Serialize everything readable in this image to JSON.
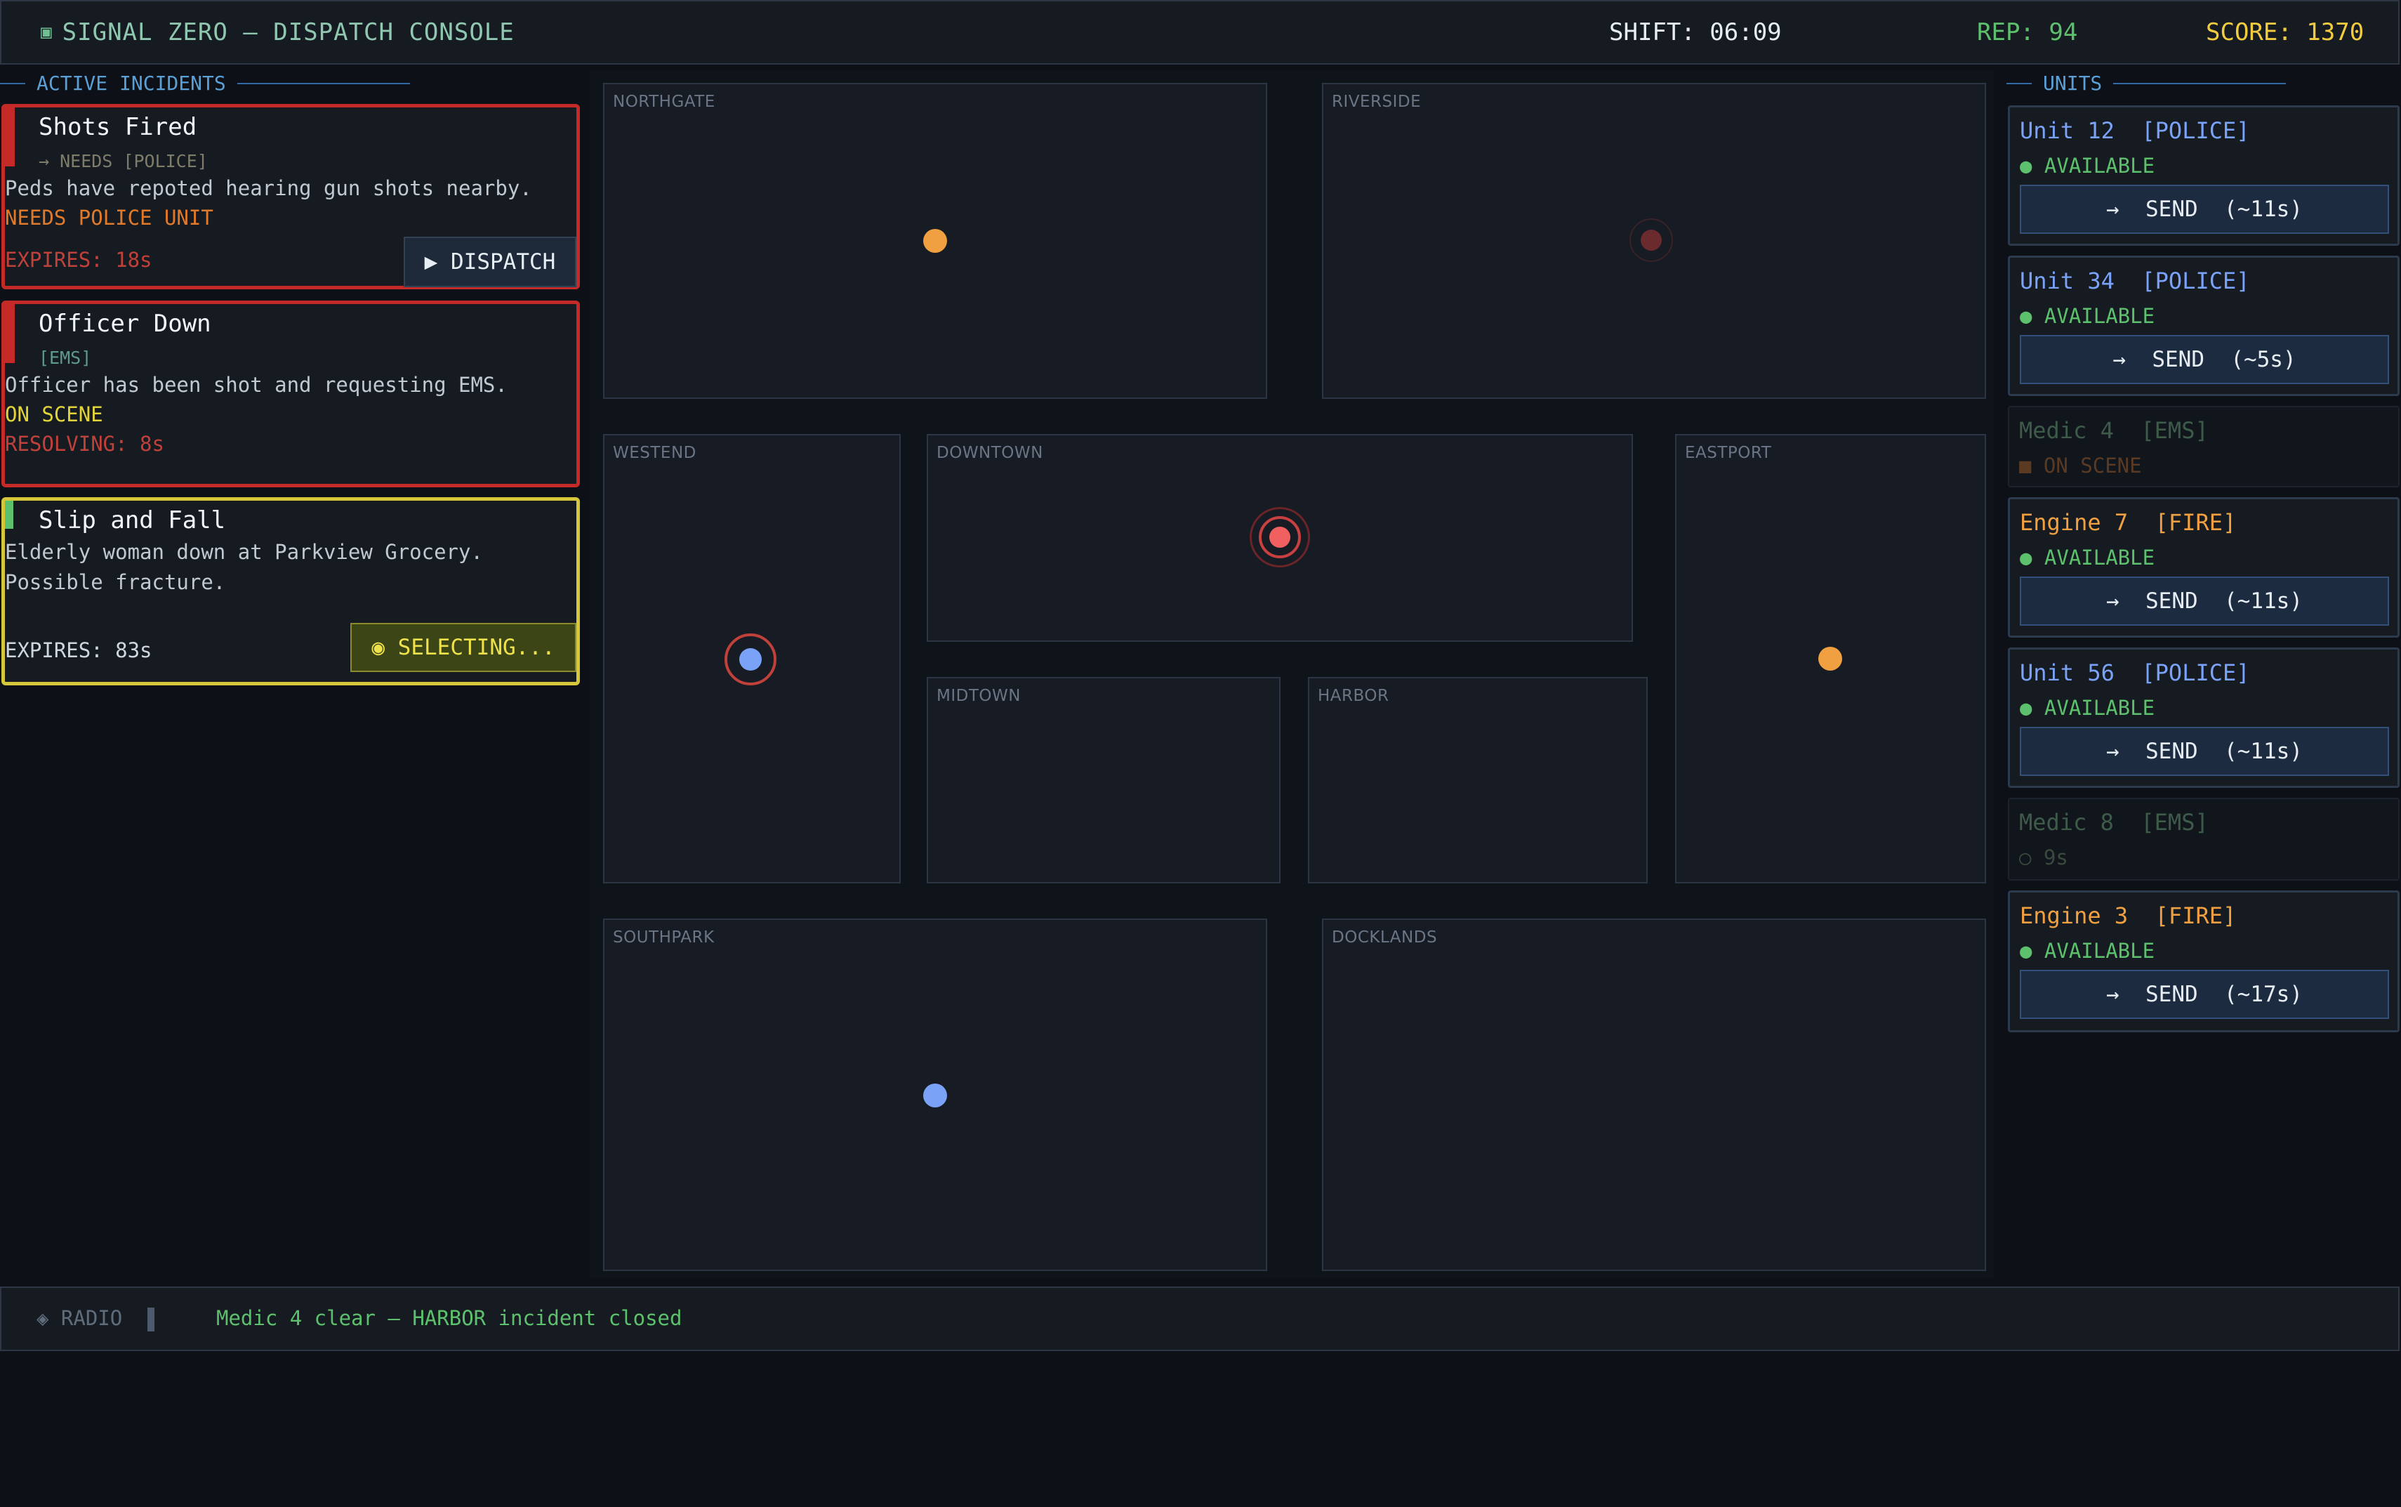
{
  "header": {
    "title_icon": "terminal-square-icon",
    "title": "SIGNAL ZERO — DISPATCH CONSOLE",
    "shift": "SHIFT: 06:09",
    "rep": "REP: 94",
    "score": "SCORE: 1370"
  },
  "incidents_panel": {
    "title": "ACTIVE INCIDENTS"
  },
  "incidents": [
    {
      "title": "Shots Fired",
      "needs": "→ NEEDS [POLICE]",
      "description": "Peds have repoted hearing gun shots nearby.",
      "status": "NEEDS POLICE UNIT",
      "timer": "EXPIRES: 18s",
      "action": "▶  DISPATCH"
    },
    {
      "title": "Officer Down",
      "needs": "[EMS]",
      "description": "Officer has been shot and requesting EMS.",
      "status": "ON SCENE",
      "timer": "RESOLVING: 8s"
    },
    {
      "title": "Slip and Fall",
      "description_1": "Elderly woman down at Parkview Grocery.",
      "description_2": "Possible fracture.",
      "timer": "EXPIRES: 83s",
      "action": "◉  SELECTING..."
    }
  ],
  "map": {
    "zones": [
      "NORTHGATE",
      "RIVERSIDE",
      "WESTEND",
      "DOWNTOWN",
      "EASTPORT",
      "MIDTOWN",
      "HARBOR",
      "SOUTHPARK",
      "DOCKLANDS"
    ]
  },
  "units_panel": {
    "title": "UNITS"
  },
  "units": [
    {
      "name": "Unit 12  [POLICE]",
      "status": "● AVAILABLE",
      "send": "→  SEND  (~11s)"
    },
    {
      "name": "Unit 34  [POLICE]",
      "status": "● AVAILABLE",
      "send": "→  SEND  (~5s)"
    },
    {
      "name": "Medic 4  [EMS]",
      "status": "■ ON SCENE"
    },
    {
      "name": "Engine 7  [FIRE]",
      "status": "● AVAILABLE",
      "send": "→  SEND  (~11s)"
    },
    {
      "name": "Unit 56  [POLICE]",
      "status": "● AVAILABLE",
      "send": "→  SEND  (~11s)"
    },
    {
      "name": "Medic 8  [EMS]",
      "status": "○ 9s"
    },
    {
      "name": "Engine 3  [FIRE]",
      "status": "● AVAILABLE",
      "send": "→  SEND  (~17s)"
    }
  ],
  "radio": {
    "label": "◈ RADIO",
    "message": "Medic 4 clear — HARBOR incident closed"
  },
  "colors": {
    "police": "#7aa2f7",
    "fire": "#f0a040",
    "ems": "#3e5b4a",
    "alert": "#c42b28",
    "selected": "#d6c63a",
    "available": "#5cc06c"
  }
}
